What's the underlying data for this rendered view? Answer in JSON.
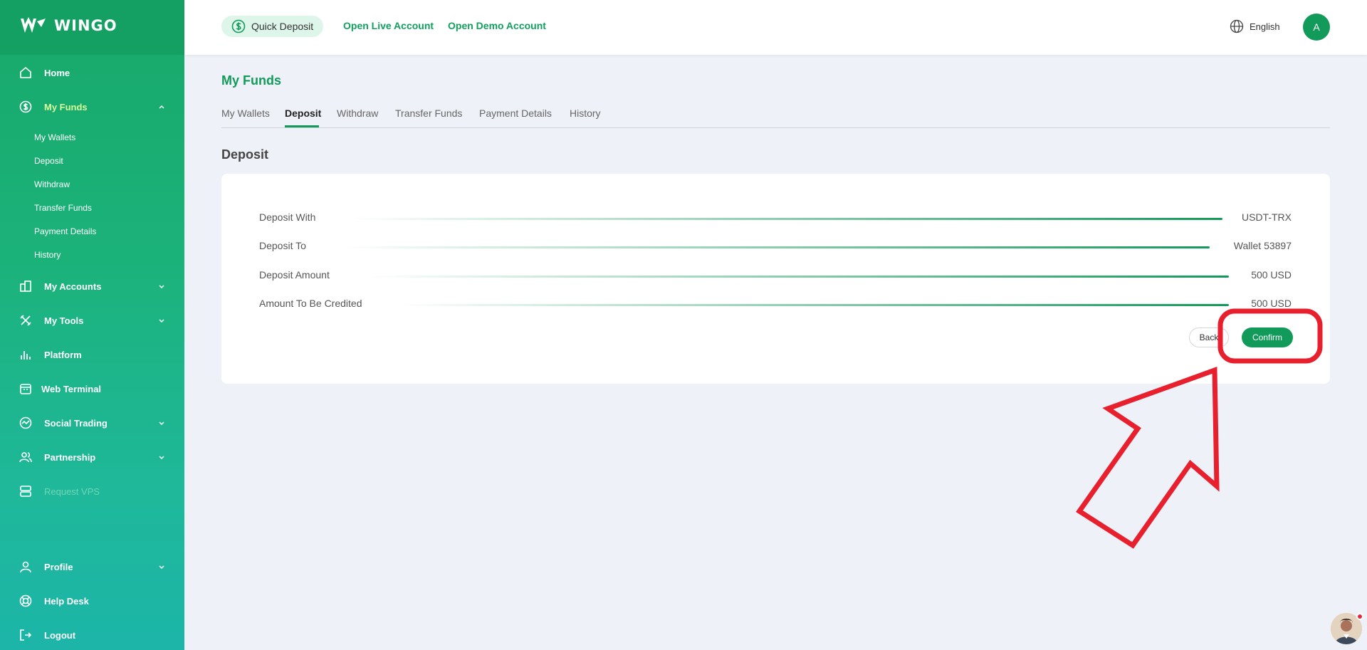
{
  "brand": {
    "name": "WINGO"
  },
  "header": {
    "quick_deposit": "Quick Deposit",
    "open_live": "Open Live Account",
    "open_demo": "Open Demo Account",
    "language": "English",
    "avatar_initial": "A"
  },
  "sidebar": {
    "home": "Home",
    "my_funds": "My Funds",
    "funds_sub": [
      "My Wallets",
      "Deposit",
      "Withdraw",
      "Transfer Funds",
      "Payment Details",
      "History"
    ],
    "my_accounts": "My Accounts",
    "my_tools": "My Tools",
    "platform": "Platform",
    "web_terminal": "Web Terminal",
    "social_trading": "Social Trading",
    "partnership": "Partnership",
    "request_vps": "Request VPS",
    "profile": "Profile",
    "help_desk": "Help Desk",
    "logout": "Logout"
  },
  "main": {
    "title": "My Funds",
    "tabs": [
      "My Wallets",
      "Deposit",
      "Withdraw",
      "Transfer Funds",
      "Payment Details",
      "History"
    ],
    "section_title": "Deposit",
    "rows": [
      {
        "label": "Deposit With",
        "value": "USDT-TRX"
      },
      {
        "label": "Deposit To",
        "value": "Wallet 53897"
      },
      {
        "label": "Deposit Amount",
        "value": "500 USD"
      },
      {
        "label": "Amount To Be Credited",
        "value": "500 USD"
      }
    ],
    "back": "Back",
    "confirm": "Confirm"
  },
  "colors": {
    "brand": "#129a5a",
    "annotation": "#e8202e"
  }
}
